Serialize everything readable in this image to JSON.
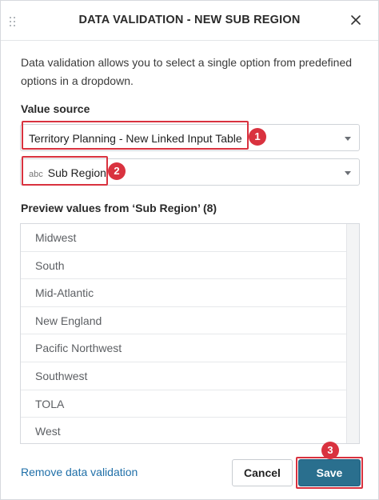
{
  "dialog": {
    "title": "DATA VALIDATION - NEW SUB REGION",
    "description": "Data validation allows you to select a single option from predefined options in a dropdown."
  },
  "value_source": {
    "label": "Value source",
    "table_select": "Territory Planning - New Linked Input Table",
    "column_type_tag": "abc",
    "column_select": "Sub Region"
  },
  "preview": {
    "label": "Preview values from ‘Sub Region’ (8)",
    "items": [
      "Midwest",
      "South",
      "Mid-Atlantic",
      "New England",
      "Pacific Northwest",
      "Southwest",
      "TOLA",
      "West"
    ]
  },
  "footer": {
    "remove_link": "Remove data validation",
    "cancel_label": "Cancel",
    "save_label": "Save"
  },
  "annotations": [
    "1",
    "2",
    "3"
  ],
  "colors": {
    "highlight": "#d9323f",
    "save_button": "#2a6f8e",
    "link": "#1f6fa8"
  },
  "icons": {
    "drag": "drag-handle-icon",
    "close": "close-icon",
    "dropdown": "chevron-down-icon"
  }
}
